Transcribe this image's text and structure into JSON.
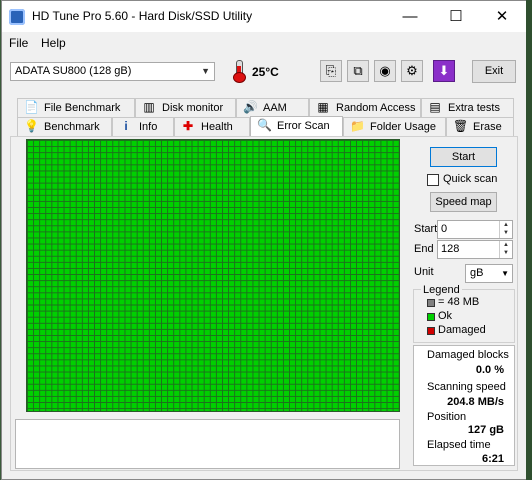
{
  "window": {
    "title": "HD Tune Pro 5.60 - Hard Disk/SSD Utility",
    "min_glyph": "—",
    "max_glyph": "☐",
    "close_glyph": "✕"
  },
  "menu": {
    "file": "File",
    "help": "Help"
  },
  "toolbar": {
    "drive": "ADATA SU800 (128 gB)",
    "temperature": "25°C",
    "exit_label": "Exit",
    "icons": [
      "copy-info-icon",
      "copy-screenshot-icon",
      "camera-icon",
      "options-icon",
      "save-icon"
    ]
  },
  "tabs_top": [
    {
      "label": "File Benchmark",
      "icon": "file-benchmark-icon"
    },
    {
      "label": "Disk monitor",
      "icon": "disk-monitor-icon"
    },
    {
      "label": "AAM",
      "icon": "speaker-icon"
    },
    {
      "label": "Random Access",
      "icon": "random-access-icon"
    },
    {
      "label": "Extra tests",
      "icon": "extra-tests-icon"
    }
  ],
  "tabs_bottom": [
    {
      "label": "Benchmark",
      "icon": "benchmark-icon"
    },
    {
      "label": "Info",
      "icon": "info-icon"
    },
    {
      "label": "Health",
      "icon": "health-icon"
    },
    {
      "label": "Error Scan",
      "icon": "error-scan-icon",
      "active": true
    },
    {
      "label": "Folder Usage",
      "icon": "folder-icon"
    },
    {
      "label": "Erase",
      "icon": "erase-icon"
    }
  ],
  "controls": {
    "start_label": "Start",
    "quick_scan_label": "Quick scan",
    "quick_scan_checked": false,
    "speed_map_label": "Speed map",
    "start_field_label": "Start",
    "start_value": "0",
    "end_field_label": "End",
    "end_value": "128",
    "unit_label": "Unit",
    "unit_value": "gB"
  },
  "legend": {
    "title": "Legend",
    "block_size": "= 48 MB",
    "ok": "Ok",
    "damaged": "Damaged",
    "colors": {
      "block": "#808080",
      "ok": "#00d000",
      "damaged": "#d00000"
    }
  },
  "stats": {
    "damaged_blocks_label": "Damaged blocks",
    "damaged_blocks_value": "0.0 %",
    "scanning_speed_label": "Scanning speed",
    "scanning_speed_value": "204.8 MB/s",
    "position_label": "Position",
    "position_value": "127 gB",
    "elapsed_time_label": "Elapsed time",
    "elapsed_time_value": "6:21"
  }
}
